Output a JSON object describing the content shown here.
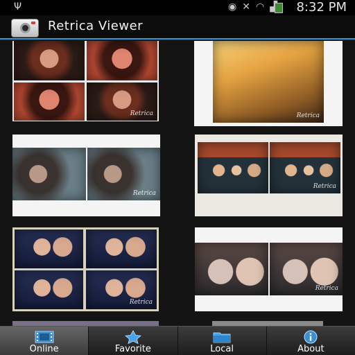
{
  "status_bar": {
    "usb_icon": "usb-icon",
    "icons": [
      "eye-icon",
      "mute-icon",
      "wifi-icon",
      "signal-icon",
      "battery-charging-icon"
    ],
    "time": "8:32 PM"
  },
  "title_bar": {
    "app_icon": "camera-app-icon",
    "title": "Retrica Viewer",
    "accent_color": "#2f9ad8"
  },
  "grid": {
    "photos": [
      {
        "style": "collage-4",
        "watermark": "Retrica"
      },
      {
        "style": "single-portrait",
        "watermark": "Retrica"
      },
      {
        "style": "collage-2-wide",
        "watermark": "Retrica"
      },
      {
        "style": "collage-2-group",
        "watermark": "Retrica"
      },
      {
        "style": "collage-4-blue",
        "watermark": "Retrica"
      },
      {
        "style": "collage-2-baby",
        "watermark": "Retrica"
      }
    ]
  },
  "bottom_nav": {
    "items": [
      {
        "label": "Online",
        "icon": "film-strip-icon",
        "active": true
      },
      {
        "label": "Favorite",
        "icon": "star-icon",
        "active": false
      },
      {
        "label": "Local",
        "icon": "folder-icon",
        "active": false
      },
      {
        "label": "About",
        "icon": "info-icon",
        "active": false
      }
    ]
  }
}
